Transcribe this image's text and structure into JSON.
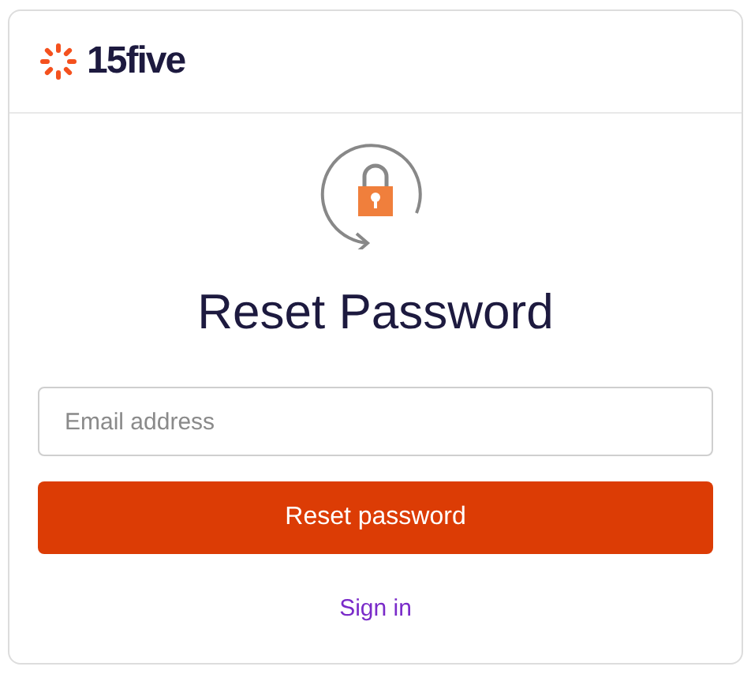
{
  "header": {
    "logo_text": "15five"
  },
  "title": "Reset Password",
  "email_field": {
    "placeholder": "Email address"
  },
  "submit_button": "Reset password",
  "sign_in_link": "Sign in"
}
